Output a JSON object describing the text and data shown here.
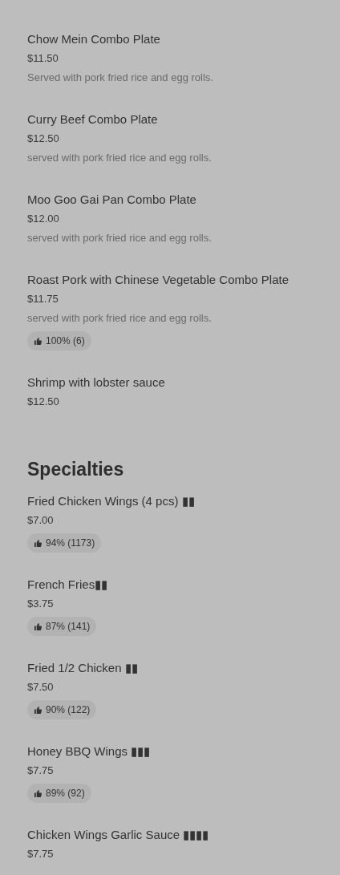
{
  "sections": [
    {
      "items": [
        {
          "name": "Chow Mein Combo Plate",
          "price": "$11.50",
          "description": "Served with pork fried rice and egg rolls."
        },
        {
          "name": "Curry Beef Combo Plate",
          "price": "$12.50",
          "description": "served with pork fried rice and egg rolls."
        },
        {
          "name": "Moo Goo Gai Pan Combo Plate",
          "price": "$12.00",
          "description": "served with pork fried rice and egg rolls."
        },
        {
          "name": "Roast Pork with Chinese Vegetable Combo Plate",
          "price": "$11.75",
          "description": "served with pork fried rice and egg rolls.",
          "rating": "100% (6)"
        },
        {
          "name": "Shrimp with lobster sauce",
          "price": "$12.50"
        }
      ]
    },
    {
      "title": "Specialties",
      "items": [
        {
          "name": "Fried Chicken Wings (4 pcs) ▮▮",
          "price": "$7.00",
          "rating": "94% (1173)"
        },
        {
          "name": "French Fries▮▮",
          "price": "$3.75",
          "rating": "87% (141)"
        },
        {
          "name": "Fried 1/2 Chicken ▮▮",
          "price": "$7.50",
          "rating": "90% (122)"
        },
        {
          "name": "Honey BBQ Wings ▮▮▮",
          "price": "$7.75",
          "rating": "89% (92)"
        },
        {
          "name": "Chicken Wings Garlic Sauce ▮▮▮▮",
          "price": "$7.75"
        }
      ]
    }
  ]
}
